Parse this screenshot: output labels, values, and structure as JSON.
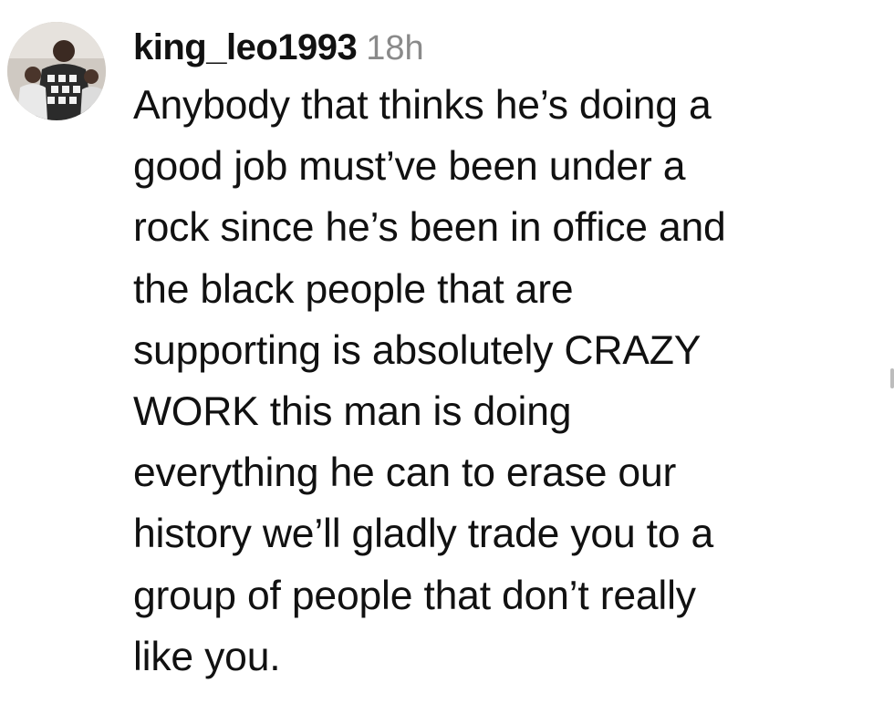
{
  "comment": {
    "username": "king_leo1993",
    "timestamp": "18h",
    "text_lines": [
      "Anybody that thinks he’s doing a",
      "good job must’ve been under a",
      "rock since he’s been in office and",
      "the black people that are",
      "supporting is absolutely CRAZY",
      "WORK this man is doing",
      "everything he can to erase our",
      "history we’ll gladly trade you to a",
      "group of people that don’t really",
      "like you."
    ]
  },
  "colors": {
    "text": "#111111",
    "timestamp": "#8a8a8a",
    "background": "#ffffff"
  },
  "icons": {
    "avatar": "profile-photo"
  }
}
